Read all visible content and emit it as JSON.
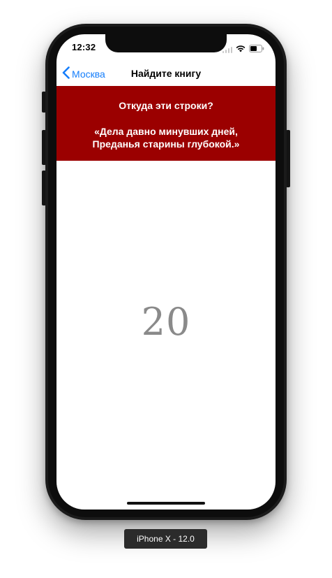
{
  "status_bar": {
    "time": "12:32",
    "signal_icon": "cellular-signal-icon",
    "wifi_icon": "wifi-icon",
    "battery_icon": "battery-icon"
  },
  "nav": {
    "back_label": "Москва",
    "back_icon": "chevron-left-icon",
    "title": "Найдите книгу"
  },
  "quote": {
    "question": "Откуда эти строки?",
    "line1": "«Дела давно минувших дней,",
    "line2": "Преданья старины глубокой.»",
    "background_color": "#9b0000"
  },
  "counter": {
    "value": "20"
  },
  "device_label": "iPhone X - 12.0",
  "colors": {
    "accent": "#157efb",
    "banner": "#9b0000"
  }
}
